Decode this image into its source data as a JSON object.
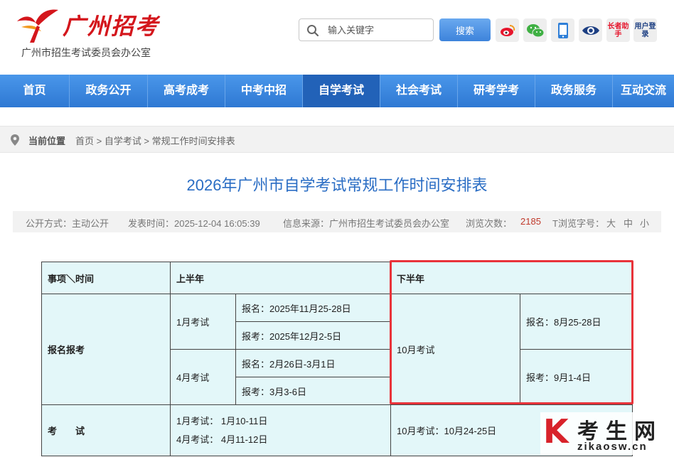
{
  "header": {
    "logo_text": "广州招考",
    "subtitle": "广州市招生考试委员会办公室",
    "search_placeholder": "输入关键字",
    "search_button": "搜索",
    "icon_buttons": [
      {
        "name": "weibo-icon",
        "color": "#e6162d"
      },
      {
        "name": "wechat-icon",
        "color": "#3fb043"
      },
      {
        "name": "mobile-icon",
        "color": "#2f7fd8"
      },
      {
        "name": "eye-icon",
        "color": "#1d3f82"
      },
      {
        "name": "elder-helper",
        "text": "长者助手",
        "color": "#e6162d"
      },
      {
        "name": "user-login",
        "text": "用户登录",
        "color": "#1d3f82"
      }
    ]
  },
  "nav": {
    "items": [
      "首页",
      "政务公开",
      "高考成考",
      "中考中招",
      "自学考试",
      "社会考试",
      "研考学考",
      "政务服务",
      "互动交流"
    ],
    "active_index": 4
  },
  "breadcrumb": {
    "label": "当前位置",
    "path": "首页 > 自学考试 > 常规工作时间安排表"
  },
  "article": {
    "title": "2026年广州市自学考试常规工作时间安排表",
    "meta": {
      "open_mode": "公开方式：主动公开",
      "publish_time": "发表时间：2025-12-04 16:05:39",
      "source": "信息来源：广州市招生考试委员会办公室",
      "views_label": "浏览次数：",
      "views_count": "2185",
      "font_label": "T浏览字号：",
      "font_large": "大",
      "font_medium": "中",
      "font_small": "小"
    }
  },
  "table": {
    "head_item": "事项＼时间",
    "head_first_half": "上半年",
    "head_second_half": "下半年",
    "reg_label": "报名报考",
    "jan_exam": "1月考试",
    "jan_reg": "报名：2025年11月25-28日",
    "jan_apply": "报考：2025年12月2-5日",
    "apr_exam": "4月考试",
    "apr_reg": "报名：2月26日-3月1日",
    "apr_apply": "报考：3月3-6日",
    "oct_exam": "10月考试",
    "oct_reg": "报名：8月25-28日",
    "oct_apply": "报考：9月1-4日",
    "exam_label": "考　　试",
    "exam_jan": "1月考试：  1月10-11日",
    "exam_apr": "4月考试：  4月11-12日",
    "exam_oct": "10月考试：10月24-25日"
  },
  "watermark": {
    "letter": "K",
    "main": "考生网",
    "url": "zikaosw.cn"
  }
}
